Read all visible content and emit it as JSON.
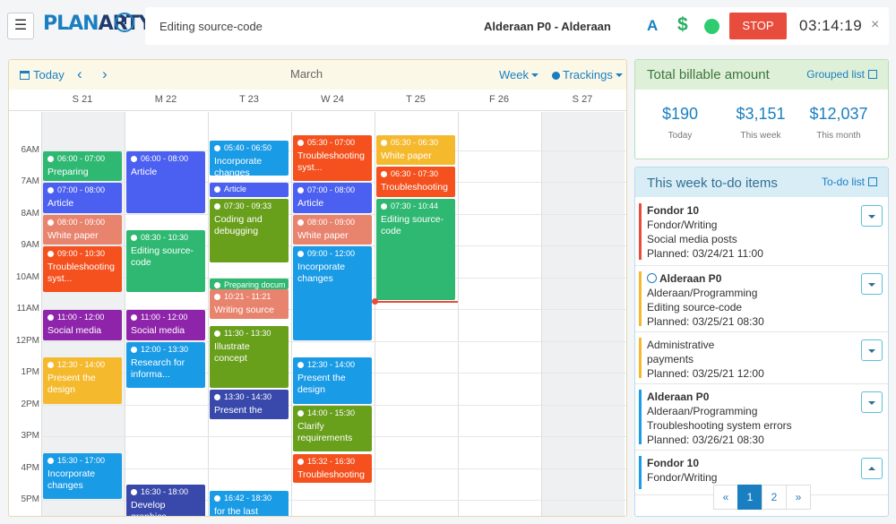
{
  "topbar": {
    "menu_icon": "hamburger-icon",
    "logo_left": "PLAN",
    "logo_right": "ARTY",
    "editing": "Editing source-code",
    "project": "Alderaan P0 - Alderaan",
    "a_label": "A",
    "dollar_label": "$",
    "stop_label": "STOP",
    "timer": "03:14:19",
    "close_label": "×"
  },
  "calendar": {
    "today_label": "Today",
    "prev_label": "‹",
    "next_label": "›",
    "month": "March",
    "view_label": "Week",
    "trackings_label": "Trackings",
    "days": [
      "S 21",
      "M 22",
      "T 23",
      "W 24",
      "T 25",
      "F 26",
      "S 27"
    ],
    "hours": [
      "6AM",
      "7AM",
      "8AM",
      "9AM",
      "10AM",
      "11AM",
      "12PM",
      "1PM",
      "2PM",
      "3PM",
      "4PM",
      "5PM"
    ],
    "events": [
      {
        "day": 0,
        "start": "06:00",
        "end": "07:00",
        "time": "06:00 - 07:00",
        "name": "Preparing",
        "color": "#2eb872"
      },
      {
        "day": 0,
        "start": "07:00",
        "end": "08:00",
        "time": "07:00 - 08:00",
        "name": "Article",
        "color": "#4b5ff0"
      },
      {
        "day": 0,
        "start": "08:00",
        "end": "09:00",
        "time": "08:00 - 09:00",
        "name": "White paper",
        "color": "#e8836e"
      },
      {
        "day": 0,
        "start": "09:00",
        "end": "10:30",
        "time": "09:00 - 10:30",
        "name": "Troubleshooting syst...",
        "color": "#f4511e"
      },
      {
        "day": 0,
        "start": "11:00",
        "end": "12:00",
        "time": "11:00 - 12:00",
        "name": "Social media",
        "color": "#8e24aa"
      },
      {
        "day": 0,
        "start": "12:30",
        "end": "14:00",
        "time": "12:30 - 14:00",
        "name": "Present the design",
        "color": "#f5b92e"
      },
      {
        "day": 0,
        "start": "15:30",
        "end": "17:00",
        "time": "15:30 - 17:00",
        "name": "Incorporate changes",
        "color": "#1a9be6"
      },
      {
        "day": 1,
        "start": "06:00",
        "end": "08:00",
        "time": "06:00 - 08:00",
        "name": "Article",
        "color": "#4b5ff0"
      },
      {
        "day": 1,
        "start": "08:30",
        "end": "10:30",
        "time": "08:30 - 10:30",
        "name": "Editing source-code",
        "color": "#2eb872"
      },
      {
        "day": 1,
        "start": "11:00",
        "end": "12:00",
        "time": "11:00 - 12:00",
        "name": "Social media",
        "color": "#8e24aa"
      },
      {
        "day": 1,
        "start": "12:00",
        "end": "13:30",
        "time": "12:00 - 13:30",
        "name": "Research for informa...",
        "color": "#1a9be6"
      },
      {
        "day": 1,
        "start": "16:30",
        "end": "18:00",
        "time": "16:30 - 18:00",
        "name": "Develop graphics",
        "color": "#3949ab"
      },
      {
        "day": 2,
        "start": "05:40",
        "end": "06:50",
        "time": "05:40 - 06:50",
        "name": "Incorporate changes",
        "color": "#1a9be6"
      },
      {
        "day": 2,
        "start": "07:00",
        "end": "07:30",
        "time": "",
        "name": "Article",
        "color": "#4b5ff0",
        "inline": true
      },
      {
        "day": 2,
        "start": "07:30",
        "end": "09:33",
        "time": "07:30 - 09:33",
        "name": "Coding and debugging",
        "color": "#689f1b"
      },
      {
        "day": 2,
        "start": "10:00",
        "end": "10:21",
        "time": "",
        "name": "Preparing docum",
        "color": "#2eb872",
        "inline": true
      },
      {
        "day": 2,
        "start": "10:21",
        "end": "11:21",
        "time": "10:21 - 11:21",
        "name": "Writing source",
        "color": "#e8836e"
      },
      {
        "day": 2,
        "start": "11:30",
        "end": "13:30",
        "time": "11:30 - 13:30",
        "name": "Illustrate concept",
        "color": "#689f1b"
      },
      {
        "day": 2,
        "start": "13:30",
        "end": "14:30",
        "time": "13:30 - 14:30",
        "name": "Present the",
        "color": "#3949ab"
      },
      {
        "day": 2,
        "start": "16:42",
        "end": "18:30",
        "time": "16:42 - 18:30",
        "name": "for the last section",
        "color": "#1a9be6"
      },
      {
        "day": 3,
        "start": "05:30",
        "end": "07:00",
        "time": "05:30 - 07:00",
        "name": "Troubleshooting syst...",
        "color": "#f4511e"
      },
      {
        "day": 3,
        "start": "07:00",
        "end": "08:00",
        "time": "07:00 - 08:00",
        "name": "Article",
        "color": "#4b5ff0"
      },
      {
        "day": 3,
        "start": "08:00",
        "end": "09:00",
        "time": "08:00 - 09:00",
        "name": "White paper",
        "color": "#e8836e"
      },
      {
        "day": 3,
        "start": "09:00",
        "end": "12:00",
        "time": "09:00 - 12:00",
        "name": "Incorporate changes",
        "color": "#1a9be6"
      },
      {
        "day": 3,
        "start": "12:30",
        "end": "14:00",
        "time": "12:30 - 14:00",
        "name": "Present the design",
        "color": "#1a9be6"
      },
      {
        "day": 3,
        "start": "14:00",
        "end": "15:30",
        "time": "14:00 - 15:30",
        "name": "Clarify requirements",
        "color": "#689f1b"
      },
      {
        "day": 3,
        "start": "15:32",
        "end": "16:30",
        "time": "15:32 - 16:30",
        "name": "Troubleshooting",
        "color": "#f4511e"
      },
      {
        "day": 4,
        "start": "05:30",
        "end": "06:30",
        "time": "05:30 - 06:30",
        "name": "White paper",
        "color": "#f5b92e"
      },
      {
        "day": 4,
        "start": "06:30",
        "end": "07:30",
        "time": "06:30 - 07:30",
        "name": "Troubleshooting",
        "color": "#f4511e"
      },
      {
        "day": 4,
        "start": "07:30",
        "end": "10:44",
        "time": "07:30 - 10:44",
        "name": "Editing source-code",
        "color": "#2eb872"
      }
    ],
    "now": {
      "day": 4,
      "time": "10:44"
    }
  },
  "billable": {
    "title": "Total billable amount",
    "link": "Grouped list",
    "stats": [
      {
        "value": "$190",
        "label": "Today"
      },
      {
        "value": "$3,151",
        "label": "This week"
      },
      {
        "value": "$12,037",
        "label": "This month"
      }
    ]
  },
  "todo": {
    "title": "This week to-do items",
    "link": "To-do list",
    "items": [
      {
        "title": "Fondor 10",
        "lines": [
          "Fondor/Writing",
          "Social media posts",
          "Planned: 03/24/21 11:00"
        ],
        "color": "#e74c3c",
        "playing": false
      },
      {
        "title": "Alderaan P0",
        "lines": [
          "Alderaan/Programming",
          "Editing source-code",
          "Planned: 03/25/21 08:30"
        ],
        "color": "#f5b92e",
        "playing": true
      },
      {
        "title": "",
        "lines": [
          "Administrative",
          "payments",
          "Planned: 03/25/21 12:00"
        ],
        "color": "#f5b92e",
        "playing": false
      },
      {
        "title": "Alderaan P0",
        "lines": [
          "Alderaan/Programming",
          "Troubleshooting system errors",
          "Planned: 03/26/21 08:30"
        ],
        "color": "#1a9be6",
        "playing": false
      },
      {
        "title": "Fondor 10",
        "lines": [
          "Fondor/Writing"
        ],
        "color": "#1a9be6",
        "playing": false
      }
    ],
    "pager": [
      "«",
      "1",
      "2",
      "»"
    ],
    "active_page": "1"
  }
}
